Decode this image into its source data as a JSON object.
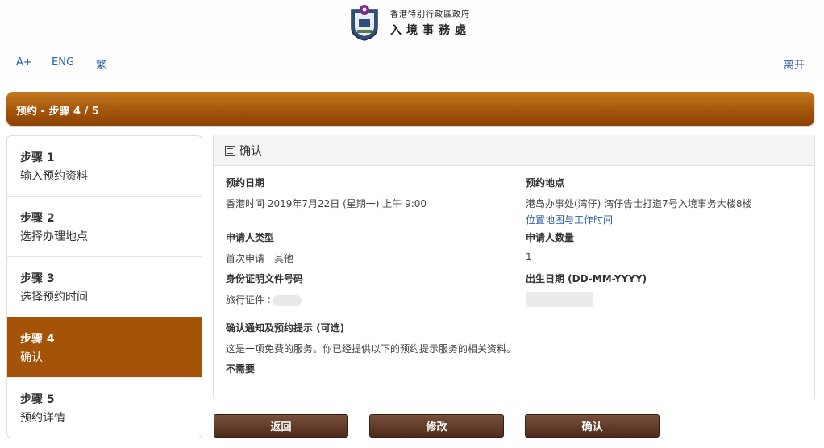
{
  "header": {
    "org_line1": "香港特别行政區政府",
    "org_line2": "入境事務處",
    "font_larger": "A+",
    "english": "ENG",
    "traditional": "繁",
    "leave": "离开"
  },
  "banner": {
    "title": "预约 - 步骤 4 / 5"
  },
  "steps": [
    {
      "num": "步骤 1",
      "label": "输入预约资料"
    },
    {
      "num": "步骤 2",
      "label": "选择办理地点"
    },
    {
      "num": "步骤 3",
      "label": "选择预约时间"
    },
    {
      "num": "步骤 4",
      "label": "确认",
      "active": true
    },
    {
      "num": "步骤 5",
      "label": "预约详情"
    }
  ],
  "confirm": {
    "title": "确认",
    "date_label": "预约日期",
    "date_value": "香港时间 2019年7月22日 (星期一) 上午 9:00",
    "location_label": "预约地点",
    "location_value": "港岛办事处(湾仔) 湾仔告士打道7号入境事务大楼8楼",
    "location_link": "位置地图与工作时间",
    "applicant_type_label": "申请人类型",
    "applicant_type_value": "首次申请 - 其他",
    "applicant_count_label": "申请人数量",
    "applicant_count_value": "1",
    "id_doc_label": "身份证明文件号码",
    "id_doc_value": "旅行证件 :",
    "dob_label": "出生日期 (DD-MM-YYYY)",
    "notify_label": "确认通知及预约提示 (可选)",
    "notify_value": "这是一项免费的服务。你已经提供以下的预约提示服务的相关资料。",
    "notify_choice": "不需要"
  },
  "buttons": {
    "back": "返回",
    "edit": "修改",
    "confirm": "确认"
  },
  "colors": {
    "accent": "#a55306",
    "link": "#2a5ea8",
    "button": "#5e3a26"
  }
}
